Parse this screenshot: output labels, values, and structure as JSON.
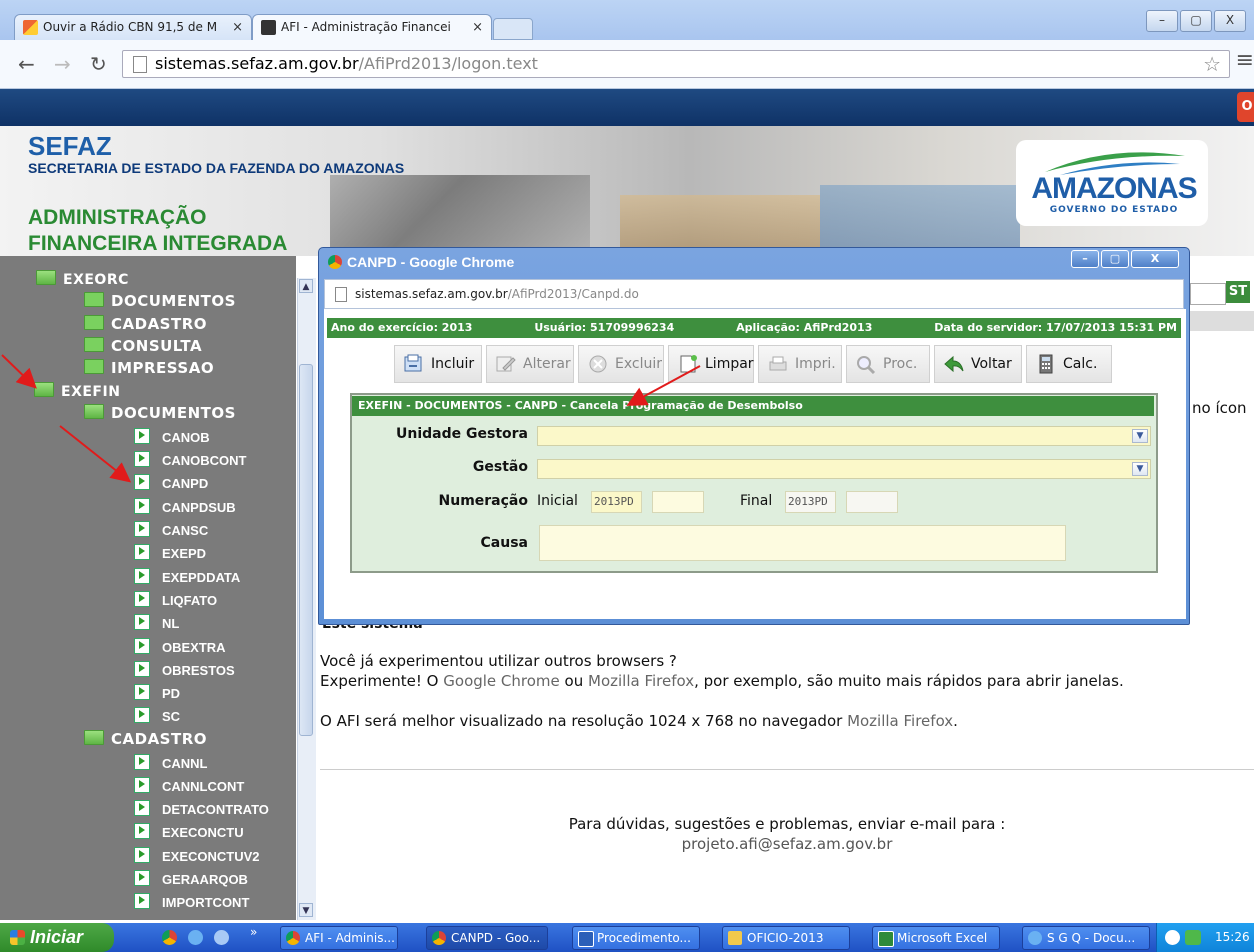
{
  "browser": {
    "tabs": [
      {
        "label": "Ouvir a Rádio CBN 91,5 de M",
        "close": "×"
      },
      {
        "label": "AFI - Administração Financei",
        "close": "×"
      }
    ],
    "window_controls": [
      "–",
      "▢",
      "X"
    ],
    "url_host": "sistemas.sefaz.am.gov.br",
    "url_path": "/AfiPrd2013/logon.text"
  },
  "header": {
    "sefaz": "SEFAZ",
    "secretaria": "SECRETARIA DE ESTADO DA FAZENDA DO AMAZONAS",
    "adm_line1": "ADMINISTRAÇÃO",
    "adm_line2": "FINANCEIRA INTEGRADA",
    "logo_main": "AMAZONAS",
    "logo_sub": "GOVERNO DO ESTADO",
    "red_button": "O"
  },
  "sidebar": {
    "exeorc": "EXEORC",
    "exeorc_children": [
      "DOCUMENTOS",
      "CADASTRO",
      "CONSULTA",
      "IMPRESSAO"
    ],
    "exefin": "EXEFIN",
    "documentos": "DOCUMENTOS",
    "documentos_items": [
      "CANOB",
      "CANOBCONT",
      "CANPD",
      "CANPDSUB",
      "CANSC",
      "EXEPD",
      "EXEPDDATA",
      "LIQFATO",
      "NL",
      "OBEXTRA",
      "OBRESTOS",
      "PD",
      "SC"
    ],
    "cadastro": "CADASTRO",
    "cadastro_items": [
      "CANNL",
      "CANNLCONT",
      "DETACONTRATO",
      "EXECONCTU",
      "EXECONCTUV2",
      "GERAARQOB",
      "IMPORTCONT"
    ]
  },
  "popup": {
    "title": "CANPD - Google Chrome",
    "controls": [
      "–",
      "▢",
      "X"
    ],
    "url_host": "sistemas.sefaz.am.gov.br",
    "url_path": "/AfiPrd2013/Canpd.do",
    "status": {
      "ano": "Ano do exercício: 2013",
      "usuario": "Usuário: 51709996234",
      "aplicacao": "Aplicação: AfiPrd2013",
      "data": "Data do servidor: 17/07/2013 15:31 PM"
    },
    "toolbar": {
      "incluir": "Incluir",
      "alterar": "Alterar",
      "excluir": "Excluir",
      "limpar": "Limpar",
      "imprimir": "Impri.",
      "proc": "Proc.",
      "voltar": "Voltar",
      "calc": "Calc."
    },
    "form": {
      "title": "EXEFIN - DOCUMENTOS - CANPD - Cancela Programação de Desembolso",
      "unidade_gestora_label": "Unidade Gestora",
      "gestao_label": "Gestão",
      "numeracao_label": "Numeração",
      "inicial_label": "Inicial",
      "inicial_prefix": "2013PD",
      "final_label": "Final",
      "final_prefix": "2013PD",
      "causa_label": "Causa"
    }
  },
  "main": {
    "fragment": "Este sistema",
    "line1": "Você já experimentou utilizar outros browsers ?",
    "line2_a": "Experimente! O ",
    "chrome": "Google Chrome",
    "line2_b": " ou ",
    "firefox": "Mozilla Firefox",
    "line2_c": ", por exemplo, são muito mais rápidos para abrir janelas.",
    "line3_a": "O AFI será melhor visualizado na resolução 1024 x 768 no navegador ",
    "firefox2": "Mozilla Firefox",
    "line3_b": ".",
    "right_fragment": "no ícon",
    "right_btn": "ST",
    "footer1": "Para dúvidas, sugestões e problemas, enviar e-mail para :",
    "footer2": "projeto.afi@sefaz.am.gov.br"
  },
  "taskbar": {
    "start": "Iniciar",
    "chevron": "»",
    "tasks": [
      "AFI - Adminis...",
      "CANPD - Goo...",
      "Procedimento...",
      "OFICIO-2013",
      "Microsoft Excel",
      "S G Q - Docu..."
    ],
    "clock": "15:26"
  },
  "colors": {
    "green_bar": "#3e8f3e",
    "sidebar_bg": "#7b7b7b",
    "field_yellow": "#fbf8c9",
    "arrow_red": "#e11b1b"
  }
}
